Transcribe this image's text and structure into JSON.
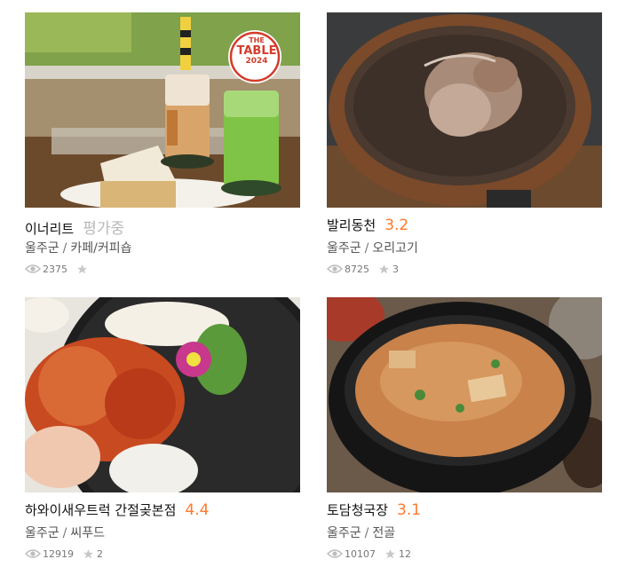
{
  "colors": {
    "score": "#ff792a",
    "pending": "#b8b8b8",
    "meta": "#555555",
    "icon": "#bdbdbd"
  },
  "restaurants": [
    {
      "name": "이너리트",
      "score": "평가중",
      "score_pending": true,
      "region": "울주군",
      "category": "카페/커피숍",
      "views": "2375",
      "favorites": "",
      "image": "cafe drinks and cake photo",
      "badge": {
        "line1": "THE",
        "line2": "TABLE",
        "line3": "2024"
      }
    },
    {
      "name": "발리동천",
      "score": "3.2",
      "score_pending": false,
      "region": "울주군",
      "category": "오리고기",
      "views": "8725",
      "favorites": "3",
      "image": "duck soup in clay pot photo"
    },
    {
      "name": "하와이새우트럭 간절곶본점",
      "score": "4.4",
      "score_pending": false,
      "region": "울주군",
      "category": "씨푸드",
      "views": "12919",
      "favorites": "2",
      "image": "garlic shrimp plate photo"
    },
    {
      "name": "토담청국장",
      "score": "3.1",
      "score_pending": false,
      "region": "울주군",
      "category": "전골",
      "views": "10107",
      "favorites": "12",
      "image": "cheonggukjang stew in stone pot photo"
    }
  ]
}
